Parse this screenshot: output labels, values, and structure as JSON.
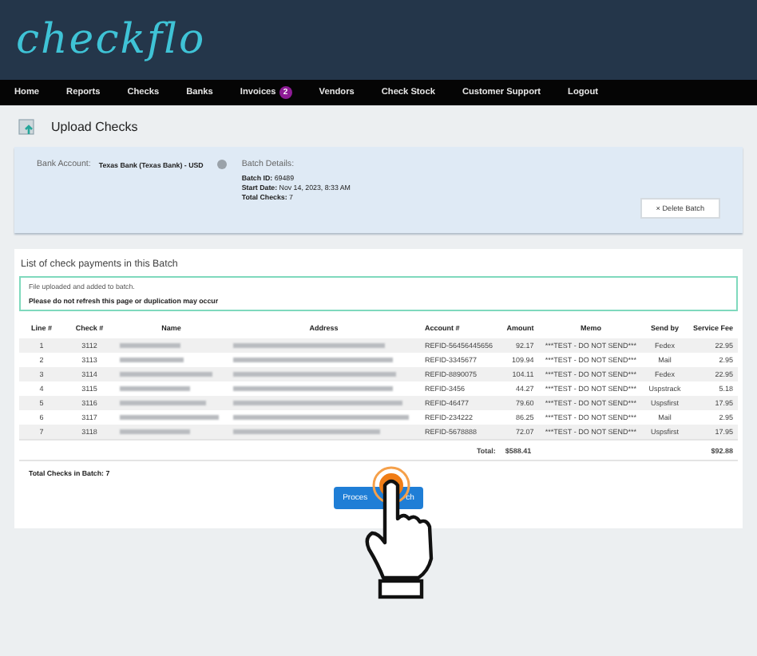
{
  "logo": "checkflo",
  "nav": [
    {
      "label": "Home"
    },
    {
      "label": "Reports"
    },
    {
      "label": "Checks"
    },
    {
      "label": "Banks"
    },
    {
      "label": "Invoices",
      "badge": "2"
    },
    {
      "label": "Vendors"
    },
    {
      "label": "Check Stock"
    },
    {
      "label": "Customer Support"
    },
    {
      "label": "Logout"
    }
  ],
  "page_title": "Upload Checks",
  "bank": {
    "label": "Bank Account:",
    "value": "Texas Bank (Texas Bank) - USD",
    "details_title": "Batch Details:",
    "details": [
      {
        "key": "Batch ID:",
        "value": "69489"
      },
      {
        "key": "Start Date:",
        "value": "Nov 14, 2023, 8:33 AM"
      },
      {
        "key": "Total Checks:",
        "value": "7"
      }
    ],
    "delete_button": "× Delete Batch"
  },
  "list_title": "List of check payments in this Batch",
  "alert": {
    "message": "File uploaded and added to batch.",
    "warning": "Please do not refresh this page or duplication may occur"
  },
  "table": {
    "columns": [
      "Line #",
      "Check #",
      "Name",
      "Address",
      "Account #",
      "Amount",
      "Memo",
      "Send by",
      "Service Fee"
    ],
    "rows": [
      {
        "line": "1",
        "check": "3112",
        "account": "REFID-56456445656",
        "amount": "92.17",
        "memo": "***TEST - DO NOT SEND***",
        "send_by": "Fedex",
        "fee": "22.95"
      },
      {
        "line": "2",
        "check": "3113",
        "account": "REFID-3345677",
        "amount": "109.94",
        "memo": "***TEST - DO NOT SEND***",
        "send_by": "Mail",
        "fee": "2.95"
      },
      {
        "line": "3",
        "check": "3114",
        "account": "REFID-8890075",
        "amount": "104.11",
        "memo": "***TEST - DO NOT SEND***",
        "send_by": "Fedex",
        "fee": "22.95"
      },
      {
        "line": "4",
        "check": "3115",
        "account": "REFID-3456",
        "amount": "44.27",
        "memo": "***TEST - DO NOT SEND***",
        "send_by": "Uspstrack",
        "fee": "5.18"
      },
      {
        "line": "5",
        "check": "3116",
        "account": "REFID-46477",
        "amount": "79.60",
        "memo": "***TEST - DO NOT SEND***",
        "send_by": "Uspsfirst",
        "fee": "17.95"
      },
      {
        "line": "6",
        "check": "3117",
        "account": "REFID-234222",
        "amount": "86.25",
        "memo": "***TEST - DO NOT SEND***",
        "send_by": "Mail",
        "fee": "2.95"
      },
      {
        "line": "7",
        "check": "3118",
        "account": "REFID-5678888",
        "amount": "72.07",
        "memo": "***TEST - DO NOT SEND***",
        "send_by": "Uspsfirst",
        "fee": "17.95"
      }
    ],
    "total_label": "Total:",
    "total_amount": "$588.41",
    "total_fee": "$92.88"
  },
  "total_checks": "Total Checks in Batch: 7",
  "process_button": {
    "visible_parts": [
      "Proces",
      "ch"
    ]
  }
}
